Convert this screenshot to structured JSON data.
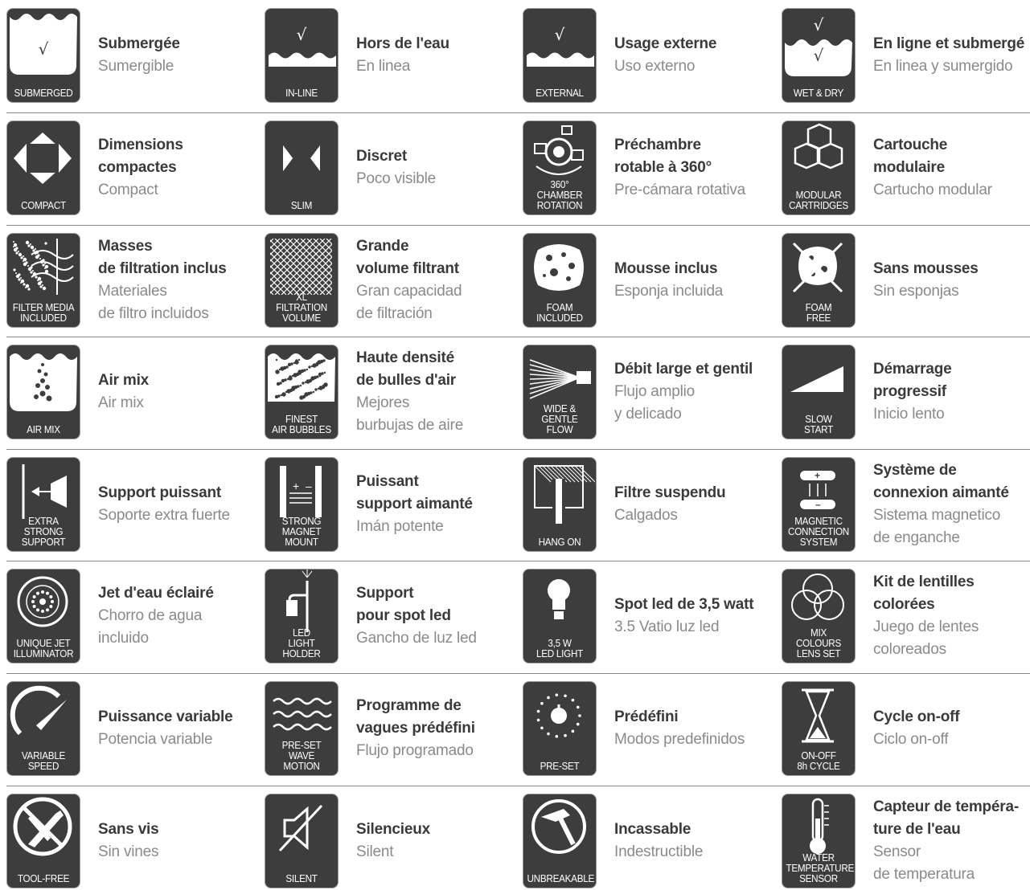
{
  "features": [
    {
      "icon": "submerged-icon",
      "label": "SUBMERGED",
      "title": "Submergée",
      "subtitle": "Sumergible",
      "tick": "√"
    },
    {
      "icon": "in-line-icon",
      "label": "IN-LINE",
      "title": "Hors de l'eau",
      "subtitle": "En linea",
      "tick": "√"
    },
    {
      "icon": "external-icon",
      "label": "EXTERNAL",
      "title": "Usage externe",
      "subtitle": "Uso externo",
      "tick": "√"
    },
    {
      "icon": "wet-dry-icon",
      "label": "WET & DRY",
      "title": "En ligne et submergé",
      "subtitle": "En linea y sumergido",
      "tick": "√"
    },
    {
      "icon": "compact-icon",
      "label": "COMPACT",
      "title": "Dimensions\ncompactes",
      "subtitle": "Compact"
    },
    {
      "icon": "slim-icon",
      "label": "SLIM",
      "title": "Discret",
      "subtitle": "Poco visible"
    },
    {
      "icon": "chamber-rotation-icon",
      "label": "360°\nCHAMBER\nROTATION",
      "title": "Préchambre\nrotable à 360°",
      "subtitle": "Pre-cámara rotativa"
    },
    {
      "icon": "modular-cartridges-icon",
      "label": "MODULAR\nCARTRIDGES",
      "title": "Cartouche\nmodulaire",
      "subtitle": "Cartucho modular"
    },
    {
      "icon": "filter-media-icon",
      "label": "FILTER MEDIA\nINCLUDED",
      "title": "Masses\nde filtration inclus",
      "subtitle": "Materiales\nde filtro incluidos"
    },
    {
      "icon": "filtration-volume-icon",
      "label": "XL\nFILTRATION\nVOLUME",
      "title": "Grande\nvolume filtrant",
      "subtitle": "Gran capacidad\nde filtración"
    },
    {
      "icon": "foam-included-icon",
      "label": "FOAM\nINCLUDED",
      "title": "Mousse inclus",
      "subtitle": "Esponja incluida"
    },
    {
      "icon": "foam-free-icon",
      "label": "FOAM\nFREE",
      "title": "Sans mousses",
      "subtitle": "Sin esponjas"
    },
    {
      "icon": "air-mix-icon",
      "label": "AIR MIX",
      "title": "Air mix",
      "subtitle": "Air mix"
    },
    {
      "icon": "air-bubbles-icon",
      "label": "FINEST\nAIR BUBBLES",
      "title": "Haute densité\nde bulles d'air",
      "subtitle": "Mejores\nburbujas de aire"
    },
    {
      "icon": "wide-flow-icon",
      "label": "WIDE &\nGENTLE\nFLOW",
      "title": "Débit large et gentil",
      "subtitle": "Flujo amplio\ny delicado"
    },
    {
      "icon": "slow-start-icon",
      "label": "SLOW\nSTART",
      "title": "Démarrage\nprogressif",
      "subtitle": "Inicio lento"
    },
    {
      "icon": "extra-support-icon",
      "label": "EXTRA\nSTRONG\nSUPPORT",
      "title": "Support puissant",
      "subtitle": "Soporte extra fuerte"
    },
    {
      "icon": "magnet-mount-icon",
      "label": "STRONG\nMAGNET\nMOUNT",
      "title": "Puissant\nsupport aimanté",
      "subtitle": "Imán potente"
    },
    {
      "icon": "hang-on-icon",
      "label": "HANG ON",
      "title": "Filtre suspendu",
      "subtitle": "Calgados"
    },
    {
      "icon": "magnetic-connection-icon",
      "label": "MAGNETIC\nCONNECTION\nSYSTEM",
      "title": "Système de\nconnexion aimanté",
      "subtitle": "Sistema magnetico\nde enganche"
    },
    {
      "icon": "jet-illuminator-icon",
      "label": "UNIQUE JET\nILLUMINATOR",
      "title": "Jet d'eau éclairé",
      "subtitle": "Chorro de agua\nincluido"
    },
    {
      "icon": "led-holder-icon",
      "label": "LED\nLIGHT\nHOLDER",
      "title": "Support\npour spot led",
      "subtitle": "Gancho de luz led"
    },
    {
      "icon": "led-light-icon",
      "label": "3,5 W\nLED LIGHT",
      "title": "Spot led de 3,5 watt",
      "subtitle": "3.5 Vatio luz led"
    },
    {
      "icon": "lens-set-icon",
      "label": "MIX\nCOLOURS\nLENS SET",
      "title": "Kit de lentilles\ncolorées",
      "subtitle": "Juego de lentes\ncoloreados"
    },
    {
      "icon": "variable-speed-icon",
      "label": "VARIABLE\nSPEED",
      "title": "Puissance variable",
      "subtitle": "Potencia variable"
    },
    {
      "icon": "wave-motion-icon",
      "label": "PRE-SET\nWAVE\nMOTION",
      "title": "Programme de\nvagues prédéfini",
      "subtitle": "Flujo programado"
    },
    {
      "icon": "pre-set-icon",
      "label": "PRE-SET",
      "title": "Prédéfini",
      "subtitle": "Modos predefinidos"
    },
    {
      "icon": "hourglass-icon",
      "label": "ON-OFF\n8h CYCLE",
      "title": "Cycle on-off",
      "subtitle": "Ciclo on-off"
    },
    {
      "icon": "tool-free-icon",
      "label": "TOOL-FREE",
      "title": "Sans vis",
      "subtitle": "Sin vines"
    },
    {
      "icon": "silent-icon",
      "label": "SILENT",
      "title": "Silencieux",
      "subtitle": "Silent"
    },
    {
      "icon": "unbreakable-icon",
      "label": "UNBREAKABLE",
      "title": "Incassable",
      "subtitle": "Indestructible"
    },
    {
      "icon": "thermometer-icon",
      "label": "WATER\nTEMPERATURE\nSENSOR",
      "title": "Capteur de tempéra-\nture de l'eau",
      "subtitle": "Sensor\nde temperatura"
    }
  ]
}
